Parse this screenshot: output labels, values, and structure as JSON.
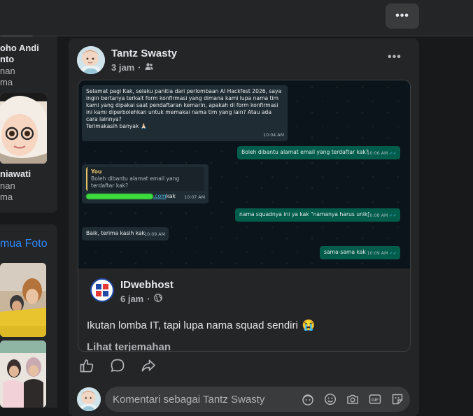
{
  "topbar": {
    "more_label": "•••"
  },
  "left_card_friends": {
    "friends": [
      {
        "name_line1": "oho Andi",
        "name_line2": "nto",
        "meta_line1": "nan",
        "meta_line2": "ma"
      },
      {
        "name_line1": "niawati",
        "meta_line1": "nan",
        "meta_line2": "ma"
      }
    ]
  },
  "left_card_photos": {
    "link_label": "mua Foto"
  },
  "post": {
    "author": "Tantz Swasty",
    "time": "3 jam",
    "separator": "·",
    "audience_icon": "friends-icon",
    "more_label": "•••",
    "chat": {
      "messages": [
        {
          "direction": "in",
          "text": "Selamat pagi Kak, selaku panitia dari perlombaan AI Hackfest 2026, saya ingin bertanya terkait form konfirmasi yang dimana kami lupa nama tim kami yang dipakai saat pendaftaran kemarin, apakah di form konfirmasi ini kami diperbolehkan untuk memakai nama tim yang lain? Atau ada cara lainnya?",
          "text2": "Terimakasih banyak 🙏🏻",
          "time": "10:04 AM"
        },
        {
          "direction": "out",
          "text": "Boleh dibantu alamat email yang terdaftar kak?",
          "time": "10:06 AM"
        },
        {
          "direction": "in",
          "reply_name": "You",
          "reply_text": "Boleh dibantu alamat email yang terdaftar kak?",
          "text_suffix": ".com",
          "text_after": " kak",
          "time": "10:07 AM"
        },
        {
          "direction": "out",
          "text": "nama squadnya ini ya kak \"namanya harus unik\"",
          "time": "10:08 AM"
        },
        {
          "direction": "in",
          "text": "Baik, terima kasih kak",
          "time": "10:09 AM"
        },
        {
          "direction": "out",
          "text": "sama-sama kak",
          "time": "10:09 AM"
        }
      ]
    },
    "shared": {
      "page_name": "IDwebhost",
      "time": "6 jam",
      "separator": "·",
      "audience_icon": "globe-icon",
      "text": "Ikutan lomba IT, tapi lupa nama squad sendiri",
      "emoji": "😭",
      "see_translation": "Lihat terjemahan"
    },
    "actions": [
      "like-icon",
      "comment-icon",
      "share-icon"
    ],
    "comment": {
      "placeholder": "Komentari sebagai Tantz Swasty",
      "icons": [
        "avatar-sticker-icon",
        "emoji-icon",
        "camera-icon",
        "gif-icon",
        "sticker-icon"
      ]
    }
  },
  "colors": {
    "background": "#18191a",
    "card": "#242526",
    "link": "#2d88ff",
    "chat_bg": "#0b141a",
    "bubble_in": "#202c33",
    "bubble_out": "#005c4b"
  }
}
